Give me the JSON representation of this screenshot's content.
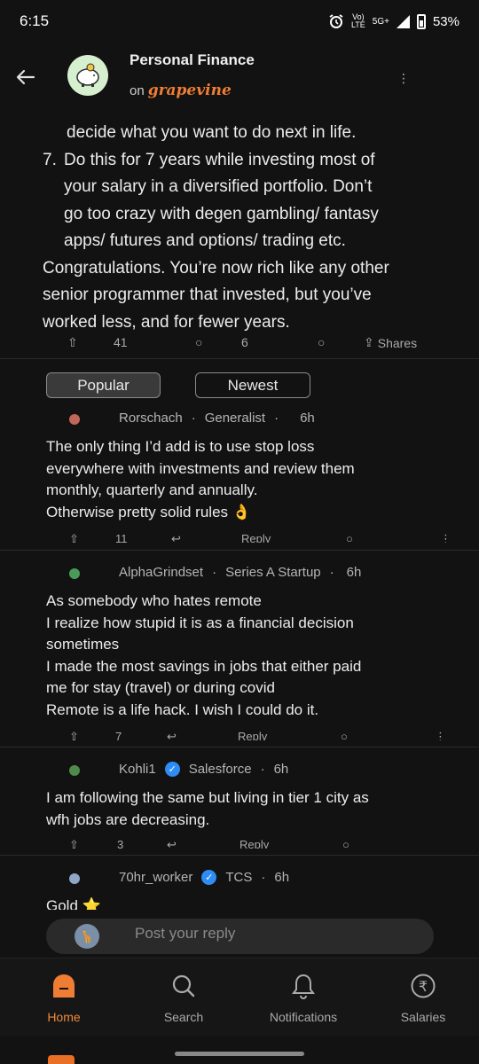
{
  "status": {
    "time": "6:15",
    "network_top": "Vo)",
    "network_bottom": "LTE",
    "network_type": "5G+",
    "battery": "53%"
  },
  "header": {
    "title": "Personal Finance",
    "on_label": "on",
    "brand": "grapevine",
    "menu_icon": "kebab-menu-icon"
  },
  "post": {
    "partial_line": "decide what you want to do next in life.",
    "item7_num": "7.",
    "item7_lines": [
      "Do this for 7 years while investing most of",
      "your salary in a diversified portfolio. Don’t",
      "go too crazy with degen gambling/ fantasy",
      "apps/ futures and options/ trading etc."
    ],
    "closing_lines": [
      "Congratulations. You’re now rich like any other",
      "senior programmer that invested, but you’ve",
      "worked less, and for fewer years."
    ],
    "upvotes": "41",
    "comments": "6",
    "shares_label": "Shares"
  },
  "sort": {
    "popular": "Popular",
    "newest": "Newest",
    "selected": "Popular"
  },
  "comments": [
    {
      "author": "Rorschach",
      "company": "Generalist",
      "time": "6h",
      "verified": false,
      "avatar_color": "#c0675a",
      "lines": [
        "The only thing I’d add is to use stop loss",
        "everywhere with investments and review them",
        "monthly, quarterly and annually.",
        "Otherwise pretty solid rules 👌"
      ],
      "upvotes": "11",
      "reply_label": "Reply"
    },
    {
      "author": "AlphaGrindset",
      "company": "Series A Startup",
      "time": "6h",
      "verified": false,
      "avatar_color": "#4a9b5a",
      "lines": [
        "As somebody who hates remote",
        "I realize how stupid it is as a financial decision",
        "sometimes",
        "I made the most savings in jobs that either paid",
        "me for stay (travel) or during covid",
        "Remote is a life hack. I wish I could do it."
      ],
      "upvotes": "7",
      "reply_label": "Reply"
    },
    {
      "author": "Kohli1",
      "company": "Salesforce",
      "time": "6h",
      "verified": true,
      "avatar_color": "#4f8a4a",
      "lines": [
        "I am following the same but living in tier 1 city as",
        "wfh jobs are decreasing."
      ],
      "upvotes": "3",
      "reply_label": "Reply"
    },
    {
      "author": "70hr_worker",
      "company": "TCS",
      "time": "6h",
      "verified": true,
      "avatar_color": "#8fa6c8",
      "lines": [
        "Gold ⭐"
      ]
    }
  ],
  "reply_bar": {
    "placeholder": "Post your reply"
  },
  "nav": {
    "home": "Home",
    "search": "Search",
    "notifications": "Notifications",
    "salaries": "Salaries"
  },
  "colors": {
    "accent": "#ef7d33",
    "background": "#121212",
    "verified": "#2f8cf5"
  }
}
